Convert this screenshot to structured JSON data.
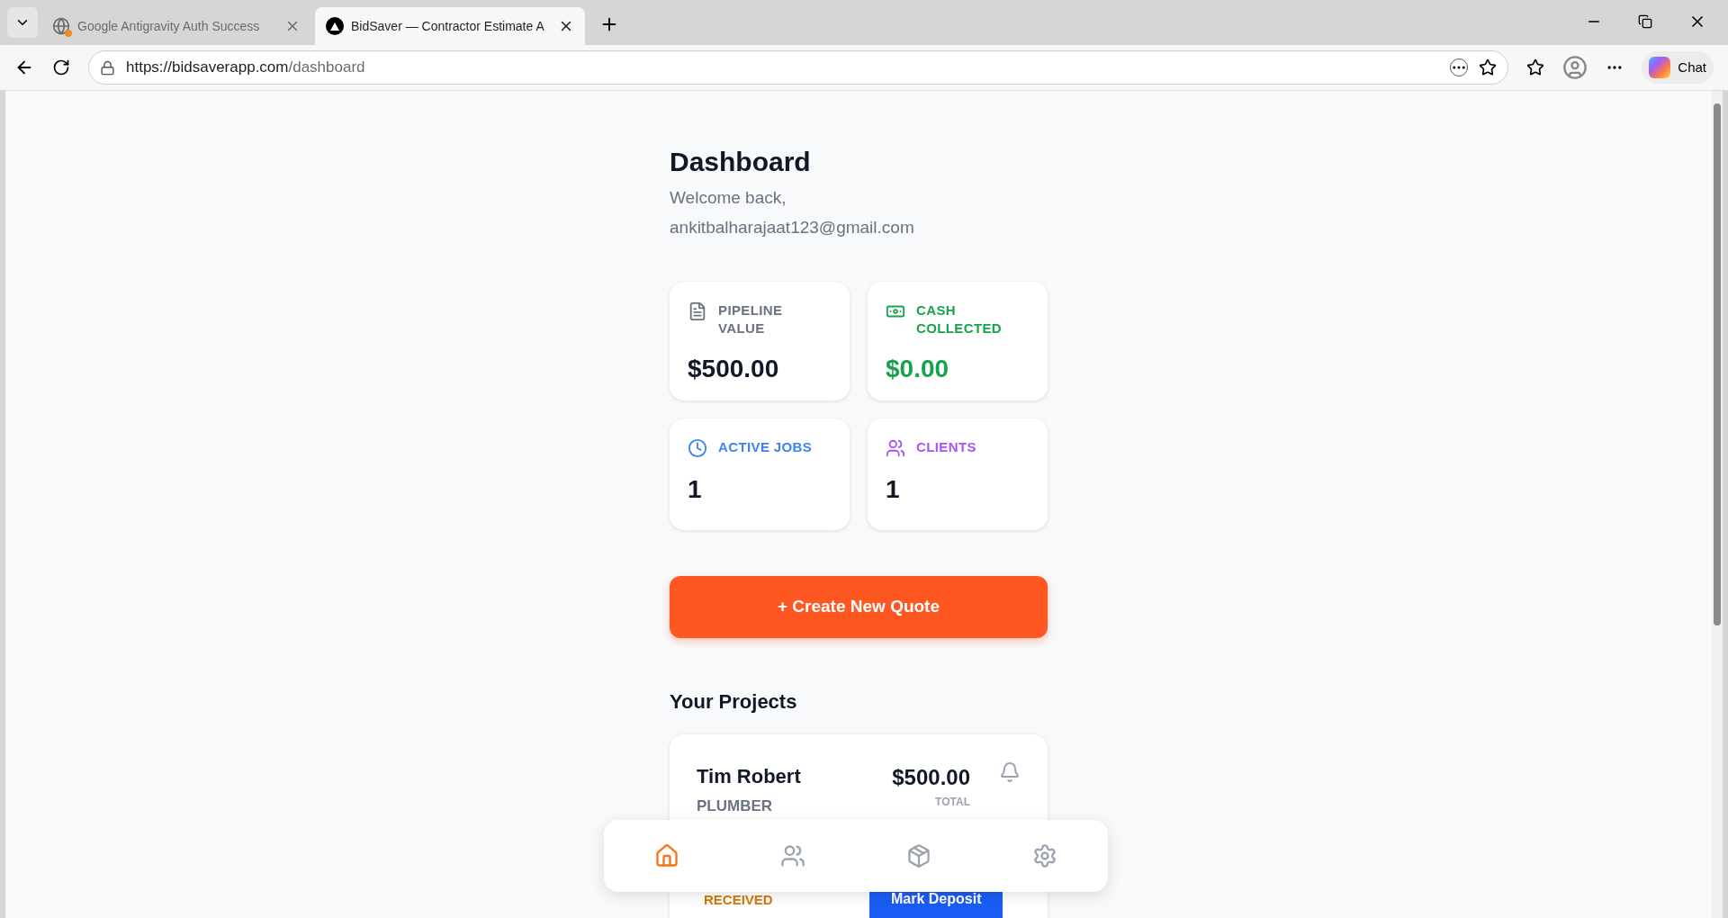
{
  "browser": {
    "tabs": [
      {
        "title": "Google Antigravity Auth Success",
        "selected": false,
        "notification": true
      },
      {
        "title": "BidSaver — Contractor Estimate A",
        "selected": true,
        "notification": false
      }
    ],
    "url": {
      "host": "https://bidsaverapp.com",
      "path": "/dashboard"
    },
    "chat_label": "Chat"
  },
  "page": {
    "title": "Dashboard",
    "welcome": "Welcome back,",
    "email": "ankitbalharajaat123@gmail.com",
    "stats": [
      {
        "kind": "document",
        "label": "PIPELINE VALUE",
        "value": "$500.00",
        "color": "#6b7280"
      },
      {
        "kind": "cash",
        "label": "CASH COLLECTED",
        "value": "$0.00",
        "color": "#16a34a"
      },
      {
        "kind": "clock",
        "label": "ACTIVE JOBS",
        "value": "1",
        "color": "#3b82f6"
      },
      {
        "kind": "people",
        "label": "CLIENTS",
        "value": "1",
        "color": "#a855f7"
      }
    ],
    "create_button": "+ Create New Quote",
    "projects_title": "Your Projects",
    "projects": [
      {
        "name": "Tim Robert",
        "trade": "PLUMBER",
        "amount": "$500.00",
        "amount_label": "TOTAL",
        "status": "RECEIVED",
        "action": "Mark Deposit"
      }
    ]
  },
  "bottom_nav": [
    {
      "kind": "home",
      "selected": true
    },
    {
      "kind": "clients",
      "selected": false
    },
    {
      "kind": "box",
      "selected": false
    },
    {
      "kind": "settings",
      "selected": false
    }
  ]
}
